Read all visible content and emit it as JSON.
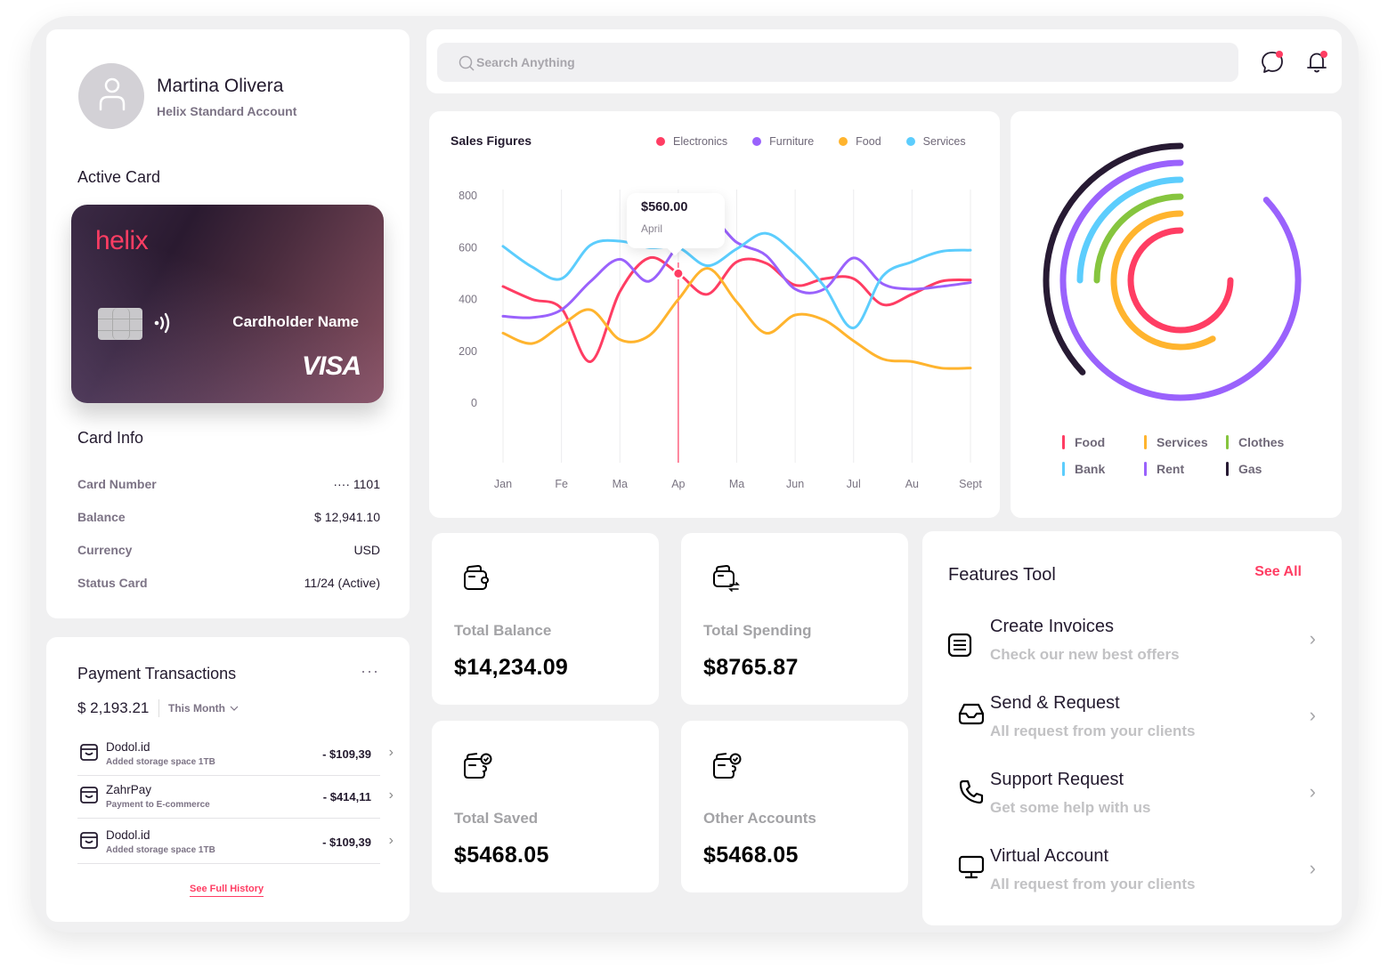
{
  "profile": {
    "name": "Martina Olivera",
    "account": "Helix Standard Account",
    "active_card_title": "Active Card",
    "card": {
      "brand": "helix",
      "cardholder": "Cardholder Name",
      "network": "VISA"
    },
    "card_info_title": "Card Info",
    "card_info": [
      {
        "label": "Card Number",
        "value": "···· 1101"
      },
      {
        "label": "Balance",
        "value": "$ 12,941.10"
      },
      {
        "label": "Currency",
        "value": "USD"
      },
      {
        "label": "Status Card",
        "value": "11/24 (Active)"
      }
    ]
  },
  "transactions": {
    "title": "Payment Transactions",
    "more": "···",
    "total": "$ 2,193.21",
    "period": "This Month",
    "items": [
      {
        "name": "Dodol.id",
        "desc": "Added storage space 1TB",
        "amount": "- $109,39"
      },
      {
        "name": "ZahrPay",
        "desc": "Payment to E-commerce",
        "amount": "- $414,11"
      },
      {
        "name": "Dodol.id",
        "desc": "Added storage space 1TB",
        "amount": "- $109,39"
      }
    ],
    "see_history": "See Full History"
  },
  "search": {
    "placeholder": "Search Anything",
    "value": ""
  },
  "colors": {
    "accent": "#ff3d63",
    "electronics": "#ff3d63",
    "furniture": "#9a62fc",
    "food": "#ffb42e",
    "services": "#5ccdfd",
    "clothes": "#86c53e",
    "gas": "#271a33"
  },
  "chart_data": [
    {
      "type": "line",
      "title": "Sales Figures",
      "xlabel": "",
      "ylabel": "",
      "categories": [
        "Jan",
        "Fe",
        "Ma",
        "Ap",
        "Ma",
        "Jun",
        "Jul",
        "Au",
        "Sept"
      ],
      "yticks": [
        0,
        200,
        400,
        600,
        800
      ],
      "ylim": [
        0,
        800
      ],
      "grid": "vertical",
      "legend": "top-right",
      "x_step": 0.5,
      "series": [
        {
          "name": "Electronics",
          "color": "#ff3d63",
          "values": [
            450,
            400,
            365,
            160,
            430,
            560,
            500,
            420,
            545,
            540,
            455,
            480,
            480,
            380,
            420,
            470,
            475
          ]
        },
        {
          "name": "Furniture",
          "color": "#9a62fc",
          "values": [
            335,
            330,
            360,
            470,
            555,
            470,
            610,
            720,
            620,
            570,
            440,
            440,
            560,
            460,
            440,
            450,
            465
          ]
        },
        {
          "name": "Food",
          "color": "#ffb42e",
          "values": [
            270,
            230,
            300,
            360,
            245,
            260,
            400,
            520,
            390,
            270,
            340,
            320,
            240,
            170,
            160,
            135,
            135
          ]
        },
        {
          "name": "Services",
          "color": "#5ccdfd",
          "values": [
            605,
            525,
            480,
            610,
            625,
            600,
            600,
            530,
            595,
            655,
            575,
            450,
            290,
            490,
            545,
            585,
            590
          ]
        }
      ],
      "tooltip": {
        "value": "$560.00",
        "label": "April",
        "series": "Electronics",
        "x_index": 3
      }
    },
    {
      "type": "radial-bar",
      "series": [
        {
          "name": "Food",
          "color": "#ff3d63",
          "fraction": 0.75
        },
        {
          "name": "Services",
          "color": "#ffb42e",
          "fraction": 0.58
        },
        {
          "name": "Clothes",
          "color": "#86c53e",
          "fraction": 0.25
        },
        {
          "name": "Bank",
          "color": "#5ccdfd",
          "fraction": 0.25,
          "extra_arc": [
            0.09,
            0.88
          ]
        },
        {
          "name": "Rent",
          "color": "#9a62fc",
          "fraction": 0.87
        },
        {
          "name": "Gas",
          "color": "#271a33",
          "fraction": 0.37
        }
      ],
      "legend": "bottom"
    }
  ],
  "stats": [
    {
      "label": "Total Balance",
      "value": "$14,234.09",
      "icon": "wallet-icon"
    },
    {
      "label": "Total Spending",
      "value": "$8765.87",
      "icon": "wallet-transfer-icon"
    },
    {
      "label": "Total Saved",
      "value": "$5468.05",
      "icon": "wallet-check-icon"
    },
    {
      "label": "Other Accounts",
      "value": "$5468.05",
      "icon": "wallet-check-icon"
    }
  ],
  "features": {
    "title": "Features Tool",
    "see_all": "See All",
    "items": [
      {
        "name": "Create Invoices",
        "desc": "Check our new best offers",
        "icon": "invoice-icon"
      },
      {
        "name": "Send & Request",
        "desc": "All request from your clients",
        "icon": "inbox-icon"
      },
      {
        "name": "Support Request",
        "desc": "Get some help with us",
        "icon": "phone-icon"
      },
      {
        "name": "Virtual Account",
        "desc": "All request from your clients",
        "icon": "monitor-icon"
      }
    ]
  }
}
